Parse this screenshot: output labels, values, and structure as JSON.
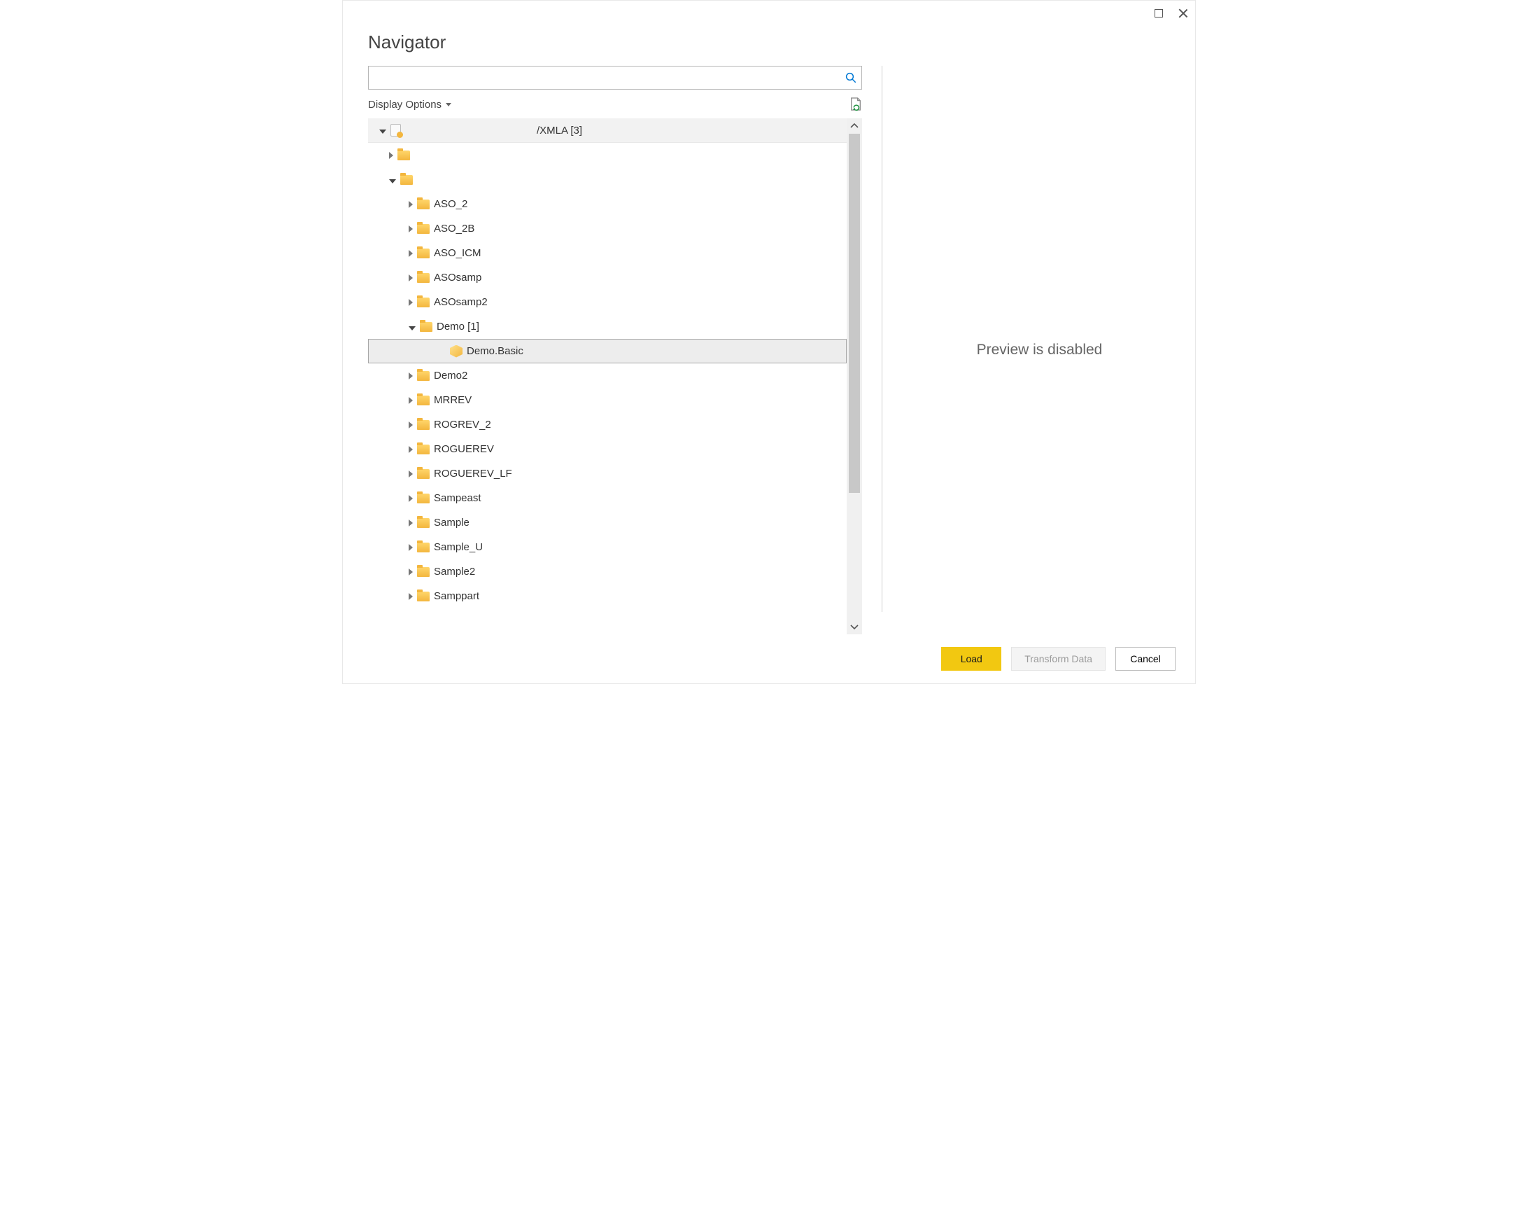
{
  "window": {
    "title": "Navigator",
    "preview_message": "Preview is disabled"
  },
  "search": {
    "value": "",
    "placeholder": ""
  },
  "toolbar": {
    "display_options_label": "Display Options"
  },
  "tree": {
    "root_label": "/XMLA [3]",
    "items": [
      {
        "label": "",
        "type": "folder",
        "expanded": false,
        "depth": 1
      },
      {
        "label": "",
        "type": "folder",
        "expanded": true,
        "depth": 1
      },
      {
        "label": "ASO_2",
        "type": "folder",
        "expanded": false,
        "depth": 2
      },
      {
        "label": "ASO_2B",
        "type": "folder",
        "expanded": false,
        "depth": 2
      },
      {
        "label": "ASO_ICM",
        "type": "folder",
        "expanded": false,
        "depth": 2
      },
      {
        "label": "ASOsamp",
        "type": "folder",
        "expanded": false,
        "depth": 2
      },
      {
        "label": "ASOsamp2",
        "type": "folder",
        "expanded": false,
        "depth": 2
      },
      {
        "label": "Demo [1]",
        "type": "folder",
        "expanded": true,
        "depth": 2
      },
      {
        "label": "Demo.Basic",
        "type": "cube",
        "selected": true,
        "depth": 3
      },
      {
        "label": "Demo2",
        "type": "folder",
        "expanded": false,
        "depth": 2
      },
      {
        "label": "MRREV",
        "type": "folder",
        "expanded": false,
        "depth": 2
      },
      {
        "label": "ROGREV_2",
        "type": "folder",
        "expanded": false,
        "depth": 2
      },
      {
        "label": "ROGUEREV",
        "type": "folder",
        "expanded": false,
        "depth": 2
      },
      {
        "label": "ROGUEREV_LF",
        "type": "folder",
        "expanded": false,
        "depth": 2
      },
      {
        "label": "Sampeast",
        "type": "folder",
        "expanded": false,
        "depth": 2
      },
      {
        "label": "Sample",
        "type": "folder",
        "expanded": false,
        "depth": 2
      },
      {
        "label": "Sample_U",
        "type": "folder",
        "expanded": false,
        "depth": 2
      },
      {
        "label": "Sample2",
        "type": "folder",
        "expanded": false,
        "depth": 2
      },
      {
        "label": "Samppart",
        "type": "folder",
        "expanded": false,
        "depth": 2
      }
    ]
  },
  "buttons": {
    "load": "Load",
    "transform": "Transform Data",
    "cancel": "Cancel"
  }
}
